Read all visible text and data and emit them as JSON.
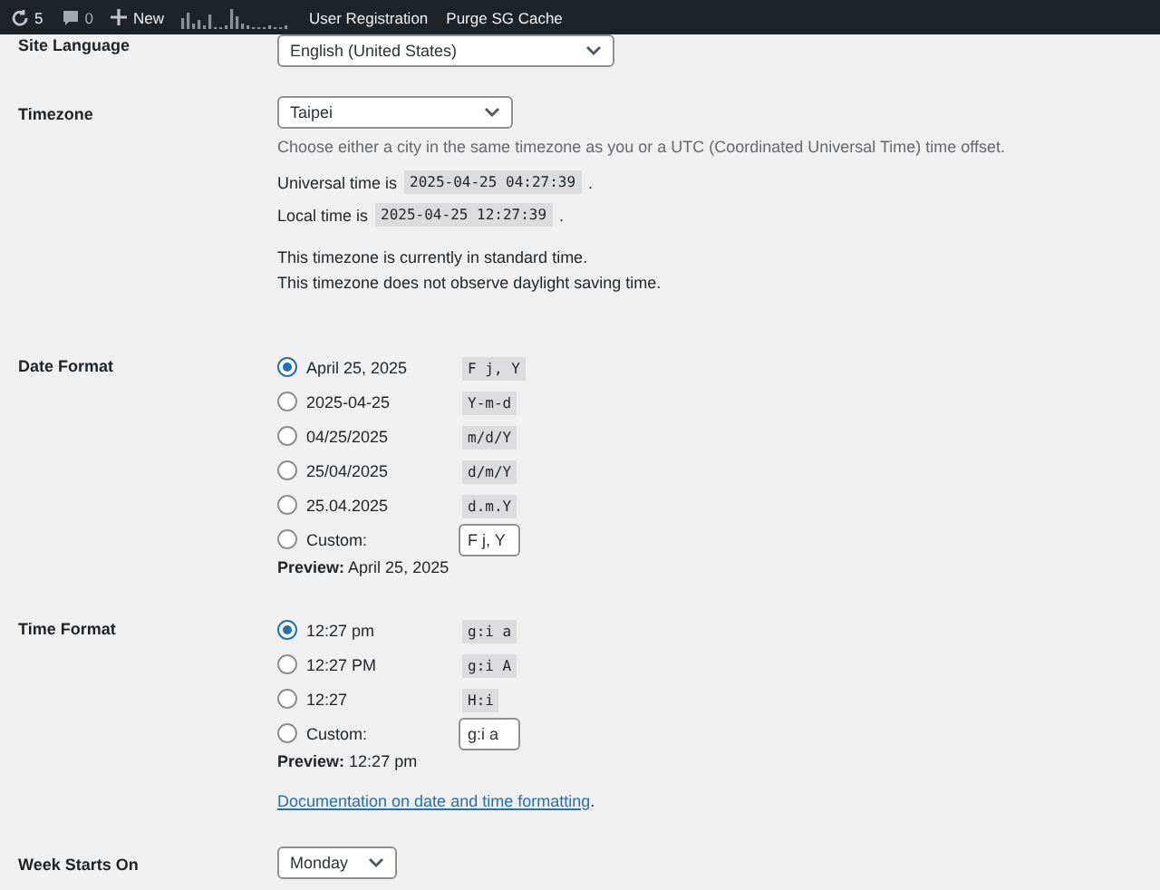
{
  "admin_bar": {
    "updates_count": "5",
    "comments_count": "0",
    "new_label": "New",
    "items": [
      "User Registration",
      "Purge SG Cache"
    ]
  },
  "site_language": {
    "label": "Site Language",
    "value": "English (United States)"
  },
  "timezone": {
    "label": "Timezone",
    "value": "Taipei",
    "description": "Choose either a city in the same timezone as you or a UTC (Coordinated Universal Time) time offset.",
    "universal_label": "Universal time is",
    "universal_time": "2025-04-25 04:27:39",
    "universal_suffix": ".",
    "local_label": "Local time is",
    "local_time": "2025-04-25 12:27:39",
    "local_suffix": ".",
    "notes": [
      "This timezone is currently in standard time.",
      "This timezone does not observe daylight saving time."
    ]
  },
  "date_format": {
    "label": "Date Format",
    "options": [
      {
        "kind": "preset",
        "label": "April 25, 2025",
        "code": "F j, Y",
        "selected": true
      },
      {
        "kind": "preset",
        "label": "2025-04-25",
        "code": "Y-m-d",
        "selected": false
      },
      {
        "kind": "preset",
        "label": "04/25/2025",
        "code": "m/d/Y",
        "selected": false
      },
      {
        "kind": "preset",
        "label": "25/04/2025",
        "code": "d/m/Y",
        "selected": false
      },
      {
        "kind": "preset",
        "label": "25.04.2025",
        "code": "d.m.Y",
        "selected": false
      },
      {
        "kind": "custom",
        "label": "Custom:",
        "value": "F j, Y",
        "selected": false
      }
    ],
    "preview_label": "Preview:",
    "preview": "April 25, 2025"
  },
  "time_format": {
    "label": "Time Format",
    "options": [
      {
        "kind": "preset",
        "label": "12:27 pm",
        "code": "g:i a",
        "selected": true
      },
      {
        "kind": "preset",
        "label": "12:27 PM",
        "code": "g:i A",
        "selected": false
      },
      {
        "kind": "preset",
        "label": "12:27",
        "code": "H:i",
        "selected": false
      },
      {
        "kind": "custom",
        "label": "Custom:",
        "value": "g:i a",
        "selected": false
      }
    ],
    "preview_label": "Preview:",
    "preview": "12:27 pm",
    "doc_link": "Documentation on date and time formatting",
    "doc_link_suffix": "."
  },
  "week_starts_on": {
    "label": "Week Starts On",
    "value": "Monday"
  }
}
